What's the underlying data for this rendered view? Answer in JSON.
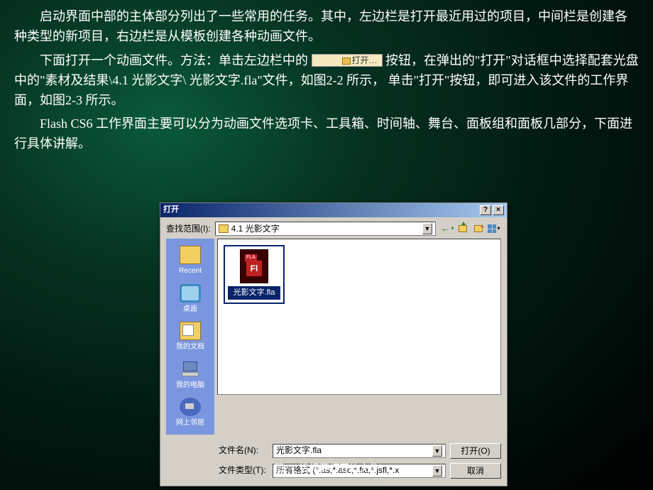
{
  "para1": "启动界面中部的主体部分列出了一些常用的任务。其中，左边栏是打开最近用过的项目，中间栏是创建各种类型的新项目，右边栏是从模板创建各种动画文件。",
  "para2_a": "下面打开一个动画文件。方法：单击左边栏中的",
  "inline_open": "打开…",
  "para2_b": "按钮，在弹出的\"打开\"对话框中选择配套光盘中的\"素材及结果\\4.1 光影文字\\ 光影文字.fla\"文件，如图2-2 所示， 单击\"打开\"按钮，即可进入该文件的工作界面，如图2-3 所示。",
  "para3": "Flash CS6 工作界面主要可以分为动画文件选项卡、工具箱、时间轴、舞台、面板组和面板几部分，下面进行具体讲解。",
  "dialog": {
    "title": "打开",
    "look_in_label": "查找范围(I):",
    "look_in_value": "4.1  光影文字",
    "places": {
      "recent": "Recent",
      "desktop": "桌面",
      "mydocs": "我的文档",
      "mycomputer": "我的电脑",
      "network": "网上邻居"
    },
    "file": {
      "label": "光影文字.fla",
      "badge": "FLA",
      "fl": "Fl"
    },
    "filename_label": "文件名(N):",
    "filename_value": "光影文字.fla",
    "filetype_label": "文件类型(T):",
    "filetype_value": "所有格式 (*.as,*.asc,*.fla,*.jsfl,*.x",
    "open_btn": "打开(O)",
    "cancel_btn": "取消"
  },
  "caption": "图2-2    选择要打开的文件"
}
